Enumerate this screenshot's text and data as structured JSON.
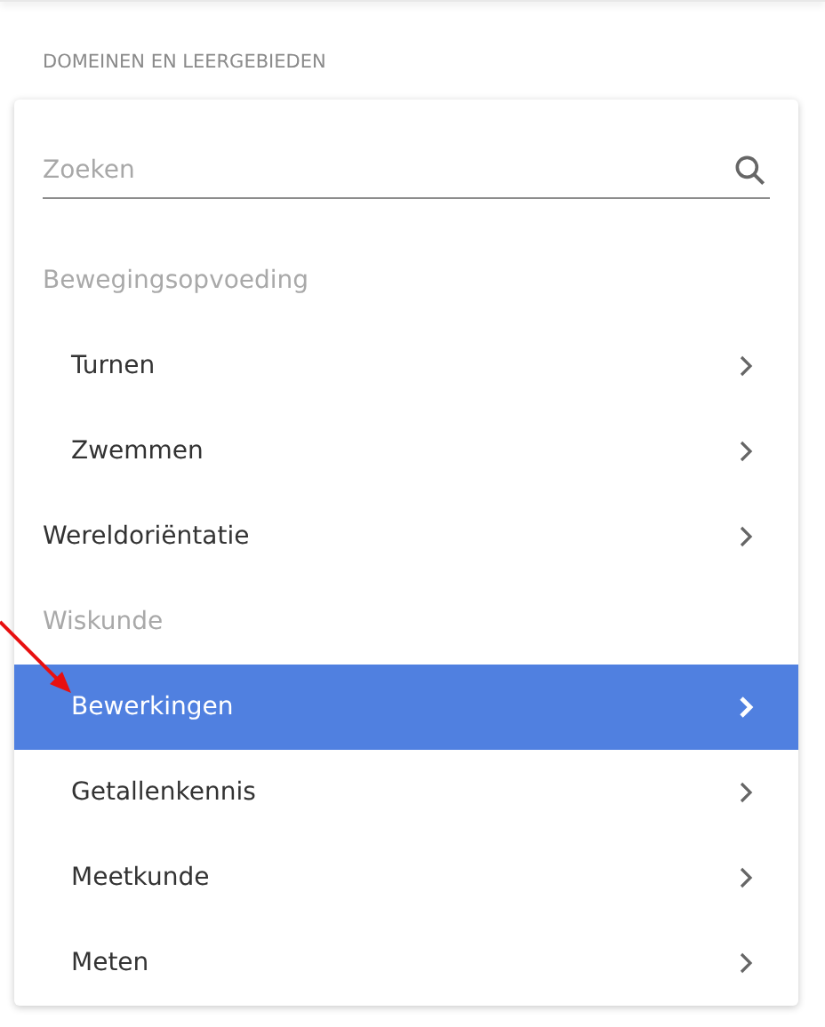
{
  "heading": "DOMEINEN EN LEERGEBIEDEN",
  "search": {
    "placeholder": "Zoeken"
  },
  "tree": [
    {
      "label": "Bewegingsopvoeding",
      "kind": "group",
      "children": [
        {
          "label": "Turnen",
          "kind": "item",
          "selected": false
        },
        {
          "label": "Zwemmen",
          "kind": "item",
          "selected": false
        }
      ]
    },
    {
      "label": "Wereldoriëntatie",
      "kind": "item",
      "selected": false
    },
    {
      "label": "Wiskunde",
      "kind": "group",
      "children": [
        {
          "label": "Bewerkingen",
          "kind": "item",
          "selected": true
        },
        {
          "label": "Getallenkennis",
          "kind": "item",
          "selected": false
        },
        {
          "label": "Meetkunde",
          "kind": "item",
          "selected": false
        },
        {
          "label": "Meten",
          "kind": "item",
          "selected": false
        }
      ]
    }
  ]
}
